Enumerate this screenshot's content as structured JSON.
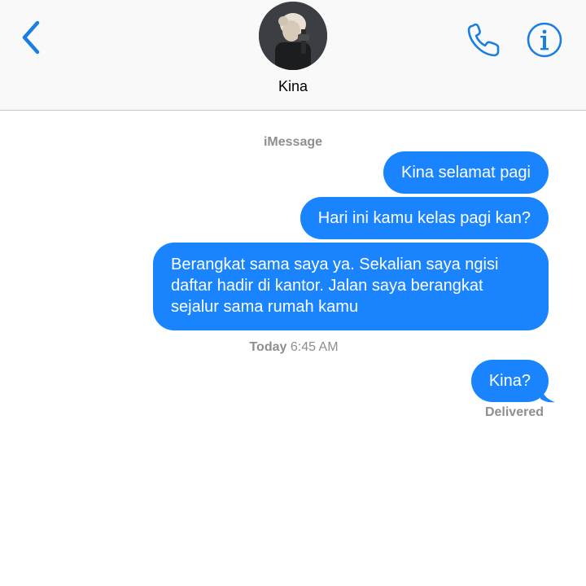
{
  "header": {
    "contact_name": "Kina",
    "back_icon": "chevron-left-icon",
    "call_icon": "phone-icon",
    "info_icon": "info-icon"
  },
  "conversation": {
    "service_label": "iMessage",
    "messages": [
      {
        "text": "Kina selamat pagi",
        "direction": "outgoing"
      },
      {
        "text": "Hari ini kamu kelas pagi kan?",
        "direction": "outgoing"
      },
      {
        "text": "Berangkat sama saya ya. Sekalian saya ngisi daftar hadir di kantor. Jalan saya berangkat sejalur sama rumah kamu",
        "direction": "outgoing"
      },
      {
        "text": "Kina?",
        "direction": "outgoing"
      }
    ],
    "timestamp_day": "Today",
    "timestamp_time": "6:45 AM",
    "delivery_status": "Delivered"
  },
  "colors": {
    "bubble_blue": "#1a84ff",
    "accent": "#1a7fe0",
    "meta_gray": "#8e8e93"
  }
}
